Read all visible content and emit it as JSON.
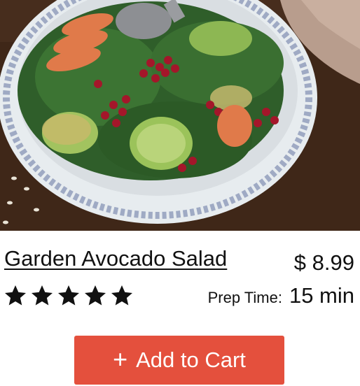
{
  "product": {
    "image_alt": "salad",
    "name": "Garden Avocado Salad",
    "price": "$ 8.99",
    "rating": 5,
    "rating_max": 5,
    "prep_label": "Prep Time:",
    "prep_value": "15 min"
  },
  "actions": {
    "add_to_cart_label": "Add to Cart",
    "add_icon": "plus-icon"
  },
  "colors": {
    "button_bg": "#e4503d",
    "button_text": "#ffffff",
    "star": "#111111"
  }
}
